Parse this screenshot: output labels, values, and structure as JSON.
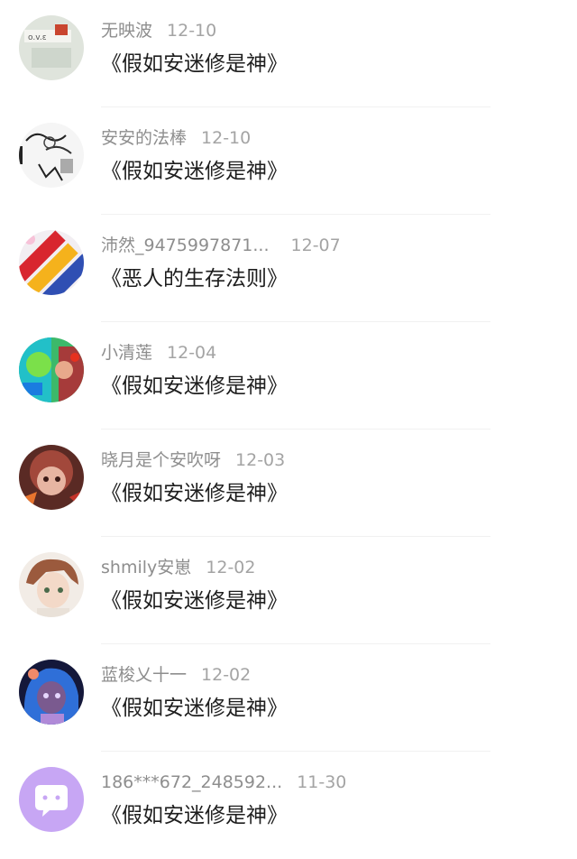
{
  "conversations": [
    {
      "name": "无映波",
      "date": "12-10",
      "message": "《假如安迷修是神》",
      "avatar": "avatar-sticker-icon"
    },
    {
      "name": "安安的法棒",
      "date": "12-10",
      "message": "《假如安迷修是神》",
      "avatar": "avatar-sketch-icon"
    },
    {
      "name": "沛然_9475997871...",
      "date": "12-07",
      "message": "《恶人的生存法则》",
      "avatar": "avatar-rainbow-icon"
    },
    {
      "name": "小清莲",
      "date": "12-04",
      "message": "《假如安迷修是神》",
      "avatar": "avatar-green-character-icon"
    },
    {
      "name": "晓月是个安吹呀",
      "date": "12-03",
      "message": "《假如安迷修是神》",
      "avatar": "avatar-red-character-icon"
    },
    {
      "name": "shmily安崽",
      "date": "12-02",
      "message": "《假如安迷修是神》",
      "avatar": "avatar-brown-hair-icon"
    },
    {
      "name": "蓝梭乂十一",
      "date": "12-02",
      "message": "《假如安迷修是神》",
      "avatar": "avatar-blue-hair-icon"
    },
    {
      "name": "186***672_248592...",
      "date": "11-30",
      "message": "《假如安迷修是神》",
      "avatar": "avatar-default-chat-icon"
    }
  ]
}
